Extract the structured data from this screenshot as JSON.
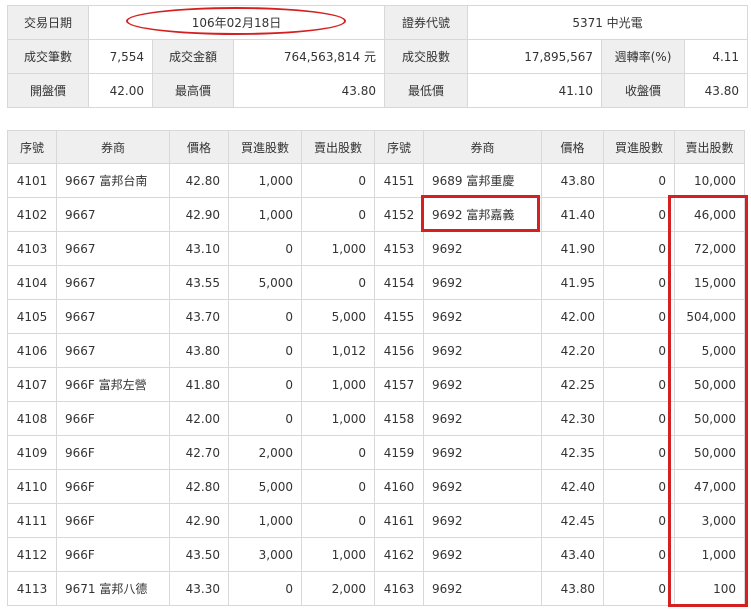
{
  "summary": {
    "trade_date_label": "交易日期",
    "trade_date": "106年02月18日",
    "stock_code_label": "證券代號",
    "stock_code": "5371 中光電",
    "deal_count_label": "成交筆數",
    "deal_count": "7,554",
    "deal_amount_label": "成交金額",
    "deal_amount": "764,563,814 元",
    "deal_shares_label": "成交股數",
    "deal_shares": "17,895,567",
    "turnover_label": "週轉率(%)",
    "turnover": "4.11",
    "open_label": "開盤價",
    "open": "42.00",
    "high_label": "最高價",
    "high": "43.80",
    "low_label": "最低價",
    "low": "41.10",
    "close_label": "收盤價",
    "close": "43.80"
  },
  "trades": {
    "headers": [
      "序號",
      "券商",
      "價格",
      "買進股數",
      "賣出股數"
    ],
    "left_rows": [
      [
        "4101",
        "9667 富邦台南",
        "42.80",
        "1,000",
        "0"
      ],
      [
        "4102",
        "9667",
        "42.90",
        "1,000",
        "0"
      ],
      [
        "4103",
        "9667",
        "43.10",
        "0",
        "1,000"
      ],
      [
        "4104",
        "9667",
        "43.55",
        "5,000",
        "0"
      ],
      [
        "4105",
        "9667",
        "43.70",
        "0",
        "5,000"
      ],
      [
        "4106",
        "9667",
        "43.80",
        "0",
        "1,012"
      ],
      [
        "4107",
        "966F 富邦左營",
        "41.80",
        "0",
        "1,000"
      ],
      [
        "4108",
        "966F",
        "42.00",
        "0",
        "1,000"
      ],
      [
        "4109",
        "966F",
        "42.70",
        "2,000",
        "0"
      ],
      [
        "4110",
        "966F",
        "42.80",
        "5,000",
        "0"
      ],
      [
        "4111",
        "966F",
        "42.90",
        "1,000",
        "0"
      ],
      [
        "4112",
        "966F",
        "43.50",
        "3,000",
        "1,000"
      ],
      [
        "4113",
        "9671 富邦八德",
        "43.30",
        "0",
        "2,000"
      ]
    ],
    "right_rows": [
      [
        "4151",
        "9689 富邦重慶",
        "43.80",
        "0",
        "10,000"
      ],
      [
        "4152",
        "9692 富邦嘉義",
        "41.40",
        "0",
        "46,000"
      ],
      [
        "4153",
        "9692",
        "41.90",
        "0",
        "72,000"
      ],
      [
        "4154",
        "9692",
        "41.95",
        "0",
        "15,000"
      ],
      [
        "4155",
        "9692",
        "42.00",
        "0",
        "504,000"
      ],
      [
        "4156",
        "9692",
        "42.20",
        "0",
        "5,000"
      ],
      [
        "4157",
        "9692",
        "42.25",
        "0",
        "50,000"
      ],
      [
        "4158",
        "9692",
        "42.30",
        "0",
        "50,000"
      ],
      [
        "4159",
        "9692",
        "42.35",
        "0",
        "50,000"
      ],
      [
        "4160",
        "9692",
        "42.40",
        "0",
        "47,000"
      ],
      [
        "4161",
        "9692",
        "42.45",
        "0",
        "3,000"
      ],
      [
        "4162",
        "9692",
        "43.40",
        "0",
        "1,000"
      ],
      [
        "4163",
        "9692",
        "43.80",
        "0",
        "100"
      ]
    ]
  },
  "annotations": {
    "highlight_color": "#d42020"
  }
}
